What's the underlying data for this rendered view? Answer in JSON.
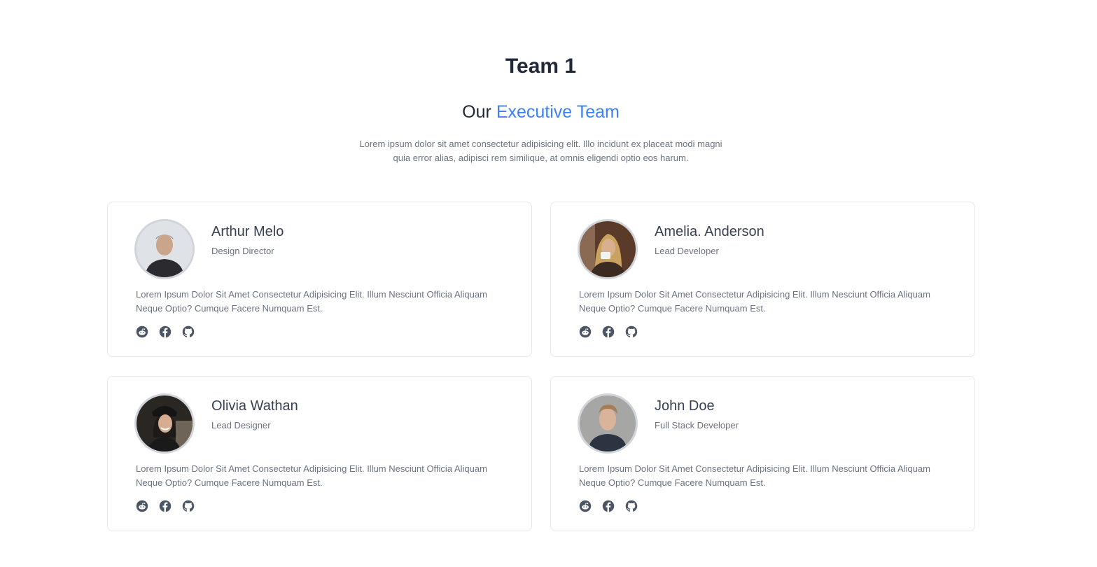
{
  "header": {
    "title": "Team 1",
    "heading_prefix": "Our",
    "heading_accent": "Executive Team",
    "description": "Lorem ipsum dolor sit amet consectetur adipisicing elit. Illo incidunt ex placeat modi magni quia error alias, adipisci rem similique, at omnis eligendi optio eos harum."
  },
  "colors": {
    "accent": "#3b82f6",
    "text_dark": "#1f2937",
    "text_muted": "#6b7280",
    "card_border": "#e5e7eb"
  },
  "members": [
    {
      "name": "Arthur Melo",
      "role": "Design Director",
      "bio": "Lorem Ipsum Dolor Sit Amet Consectetur Adipisicing Elit. Illum Nesciunt Officia Aliquam Neque Optio? Cumque Facere Numquam Est.",
      "socials": [
        "reddit-icon",
        "facebook-icon",
        "github-icon"
      ]
    },
    {
      "name": "Amelia. Anderson",
      "role": "Lead Developer",
      "bio": "Lorem Ipsum Dolor Sit Amet Consectetur Adipisicing Elit. Illum Nesciunt Officia Aliquam Neque Optio? Cumque Facere Numquam Est.",
      "socials": [
        "reddit-icon",
        "facebook-icon",
        "github-icon"
      ]
    },
    {
      "name": "Olivia Wathan",
      "role": "Lead Designer",
      "bio": "Lorem Ipsum Dolor Sit Amet Consectetur Adipisicing Elit. Illum Nesciunt Officia Aliquam Neque Optio? Cumque Facere Numquam Est.",
      "socials": [
        "reddit-icon",
        "facebook-icon",
        "github-icon"
      ]
    },
    {
      "name": "John Doe",
      "role": "Full Stack Developer",
      "bio": "Lorem Ipsum Dolor Sit Amet Consectetur Adipisicing Elit. Illum Nesciunt Officia Aliquam Neque Optio? Cumque Facere Numquam Est.",
      "socials": [
        "reddit-icon",
        "facebook-icon",
        "github-icon"
      ]
    }
  ]
}
